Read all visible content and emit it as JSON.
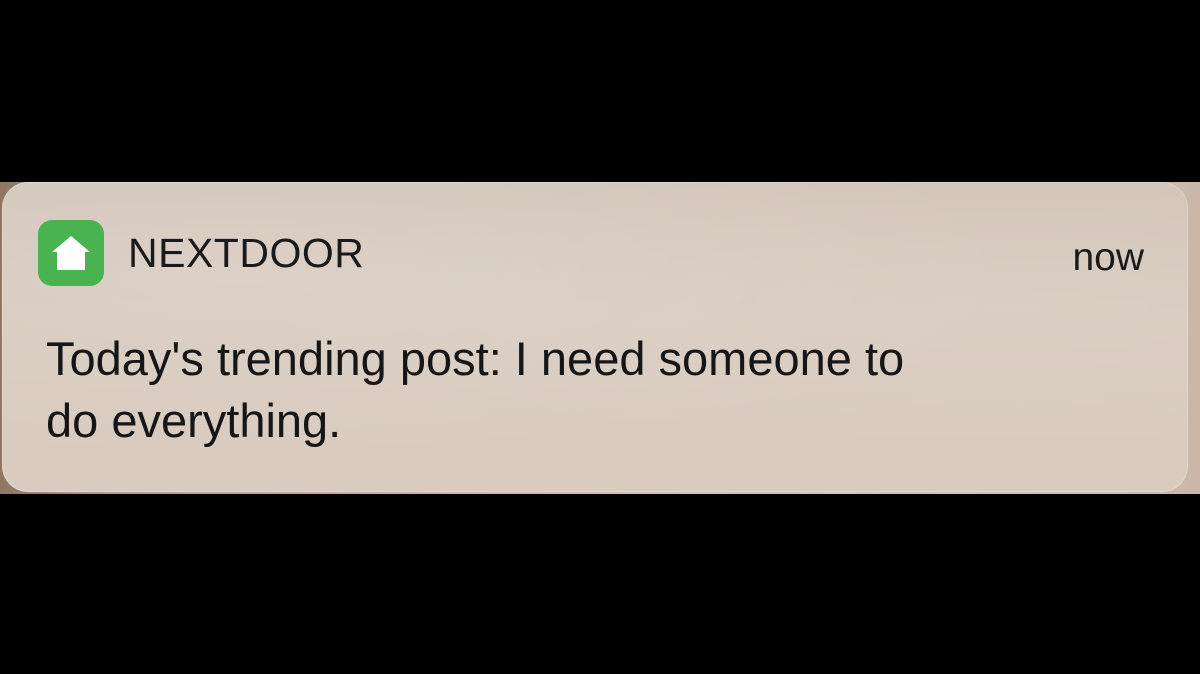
{
  "notification": {
    "app_name": "NEXTDOOR",
    "time": "now",
    "message_line1": "Today's trending post: I need someone to",
    "message_line2": "do everything.",
    "app_icon": "house-icon",
    "icon_color": "#49b34f"
  }
}
